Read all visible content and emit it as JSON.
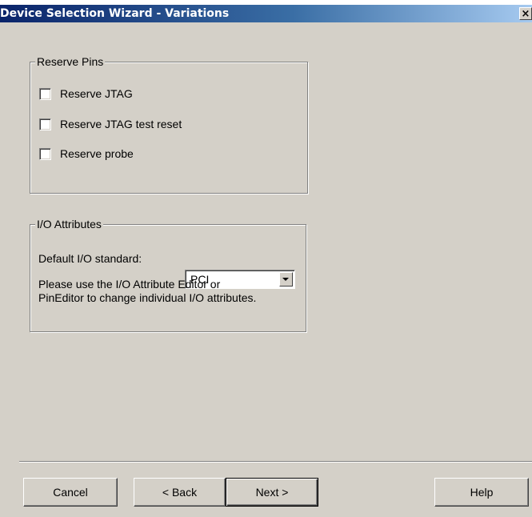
{
  "window": {
    "title": "Device Selection Wizard - Variations",
    "close_glyph": "×"
  },
  "reserve_pins": {
    "legend": "Reserve Pins",
    "items": [
      {
        "label": "Reserve JTAG",
        "checked": false
      },
      {
        "label": "Reserve JTAG test reset",
        "checked": false
      },
      {
        "label": "Reserve probe",
        "checked": false
      }
    ]
  },
  "io_attributes": {
    "legend": "I/O Attributes",
    "default_label": "Default I/O standard:",
    "default_value": "PCI",
    "note_line1": "Please use the I/O Attribute Editor or",
    "note_line2": "PinEditor to change individual I/O attributes."
  },
  "buttons": {
    "cancel": "Cancel",
    "back": "< Back",
    "next": "Next >",
    "help": "Help"
  }
}
